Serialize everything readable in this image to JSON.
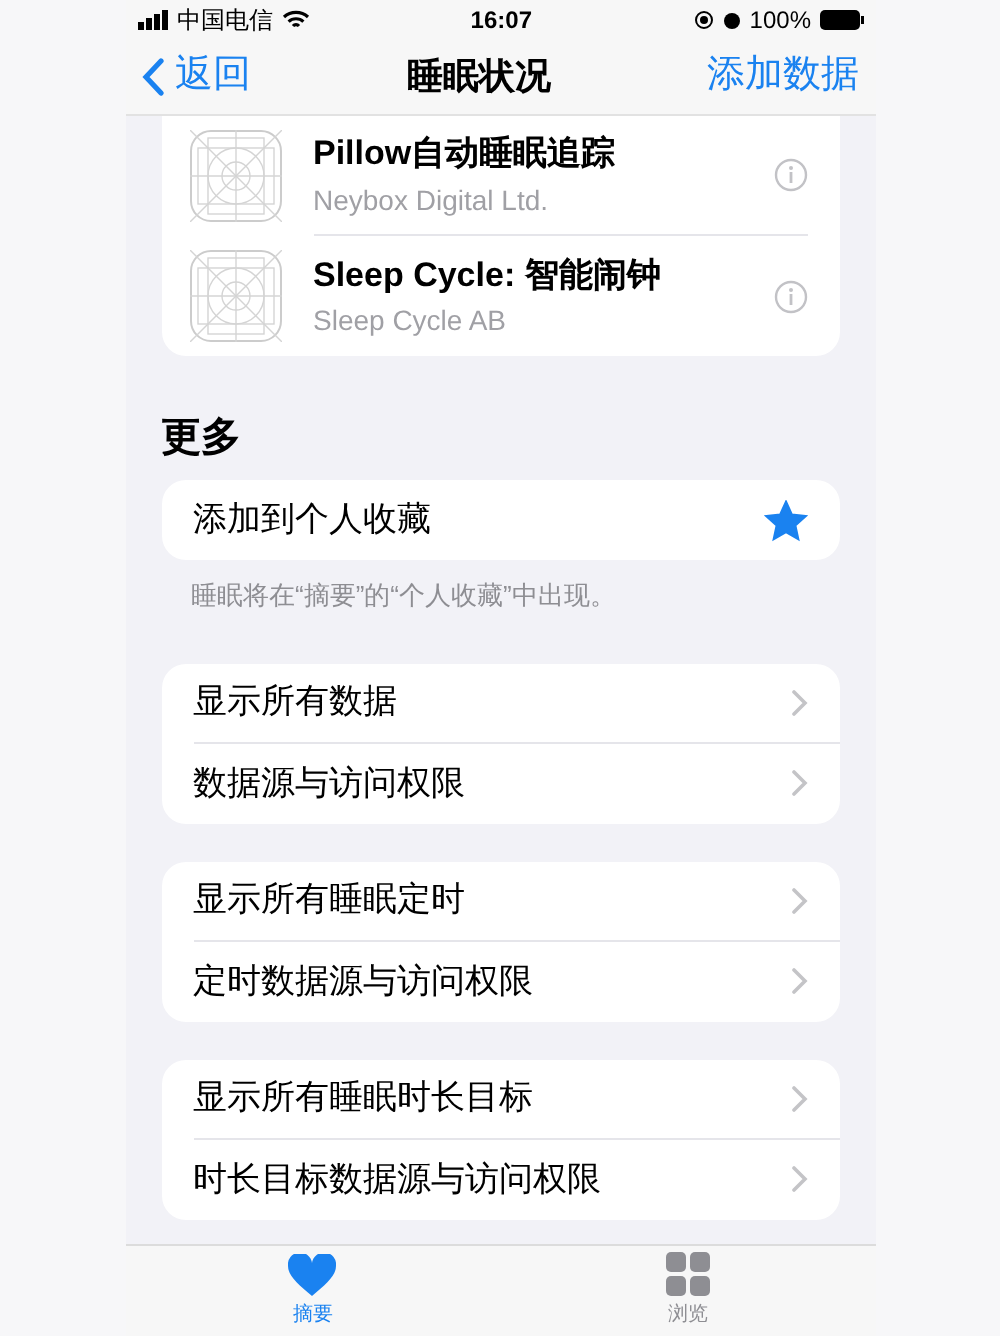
{
  "status_bar": {
    "carrier": "中国电信",
    "time": "16:07",
    "battery": "100%"
  },
  "nav": {
    "back": "返回",
    "title": "睡眠状况",
    "action": "添加数据"
  },
  "apps": [
    {
      "name": "Pillow自动睡眠追踪",
      "developer": "Neybox Digital Ltd."
    },
    {
      "name": "Sleep Cycle: 智能闹钟",
      "developer": "Sleep Cycle AB"
    }
  ],
  "more": {
    "heading": "更多",
    "favorite": {
      "label": "添加到个人收藏",
      "on": true
    },
    "footnote": "睡眠将在“摘要”的“个人收藏”中出现。"
  },
  "groups": [
    [
      "显示所有数据",
      "数据源与访问权限"
    ],
    [
      "显示所有睡眠定时",
      "定时数据源与访问权限"
    ],
    [
      "显示所有睡眠时长目标",
      "时长目标数据源与访问权限"
    ]
  ],
  "tab_bar": [
    {
      "label": "摘要",
      "kind": "heart",
      "selected": true
    },
    {
      "label": "浏览",
      "kind": "grid",
      "selected": false
    }
  ]
}
